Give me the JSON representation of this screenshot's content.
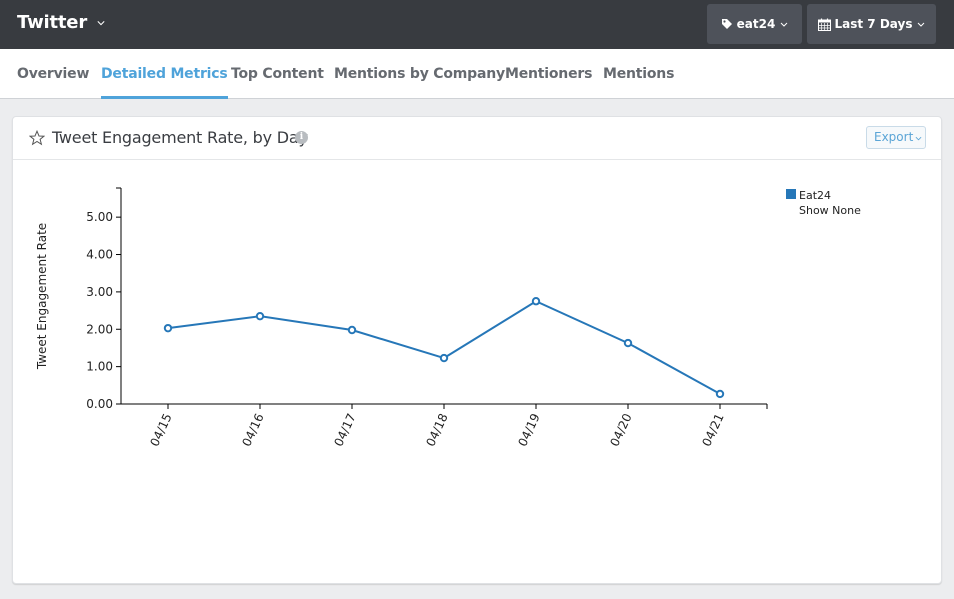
{
  "header": {
    "app_title": "Twitter",
    "tag_filter": {
      "icon": "tag-icon",
      "label": "eat24"
    },
    "date_filter": {
      "icon": "calendar-icon",
      "label": "Last 7 Days"
    }
  },
  "tabs": [
    {
      "label": "Overview",
      "active": false
    },
    {
      "label": "Detailed Metrics",
      "active": true
    },
    {
      "label": "Top Content",
      "active": false
    },
    {
      "label": "Mentions by Company",
      "active": false
    },
    {
      "label": "Mentioners",
      "active": false
    },
    {
      "label": "Mentions",
      "active": false
    }
  ],
  "card": {
    "title": "Tweet Engagement Rate, by Day",
    "info_icon": "i",
    "export_label": "Export"
  },
  "colors": {
    "accent": "#4fa3da",
    "series": "#2677b8",
    "topbar": "#383b40"
  },
  "chart_data": {
    "type": "line",
    "title": "Tweet Engagement Rate, by Day",
    "xlabel": "",
    "ylabel": "Tweet Engagement Rate",
    "x": [
      "04/15",
      "04/16",
      "04/17",
      "04/18",
      "04/19",
      "04/20",
      "04/21"
    ],
    "series": [
      {
        "name": "Eat24",
        "values": [
          2.03,
          2.35,
          1.98,
          1.23,
          2.75,
          1.63,
          0.27
        ]
      }
    ],
    "yticks": [
      "0.00",
      "1.00",
      "2.00",
      "3.00",
      "4.00",
      "5.00"
    ],
    "ylim": [
      0,
      5.78
    ],
    "grid": false,
    "legend": {
      "position": "top-right",
      "entries": [
        "Eat24"
      ],
      "toggle_label": "Show None"
    }
  }
}
